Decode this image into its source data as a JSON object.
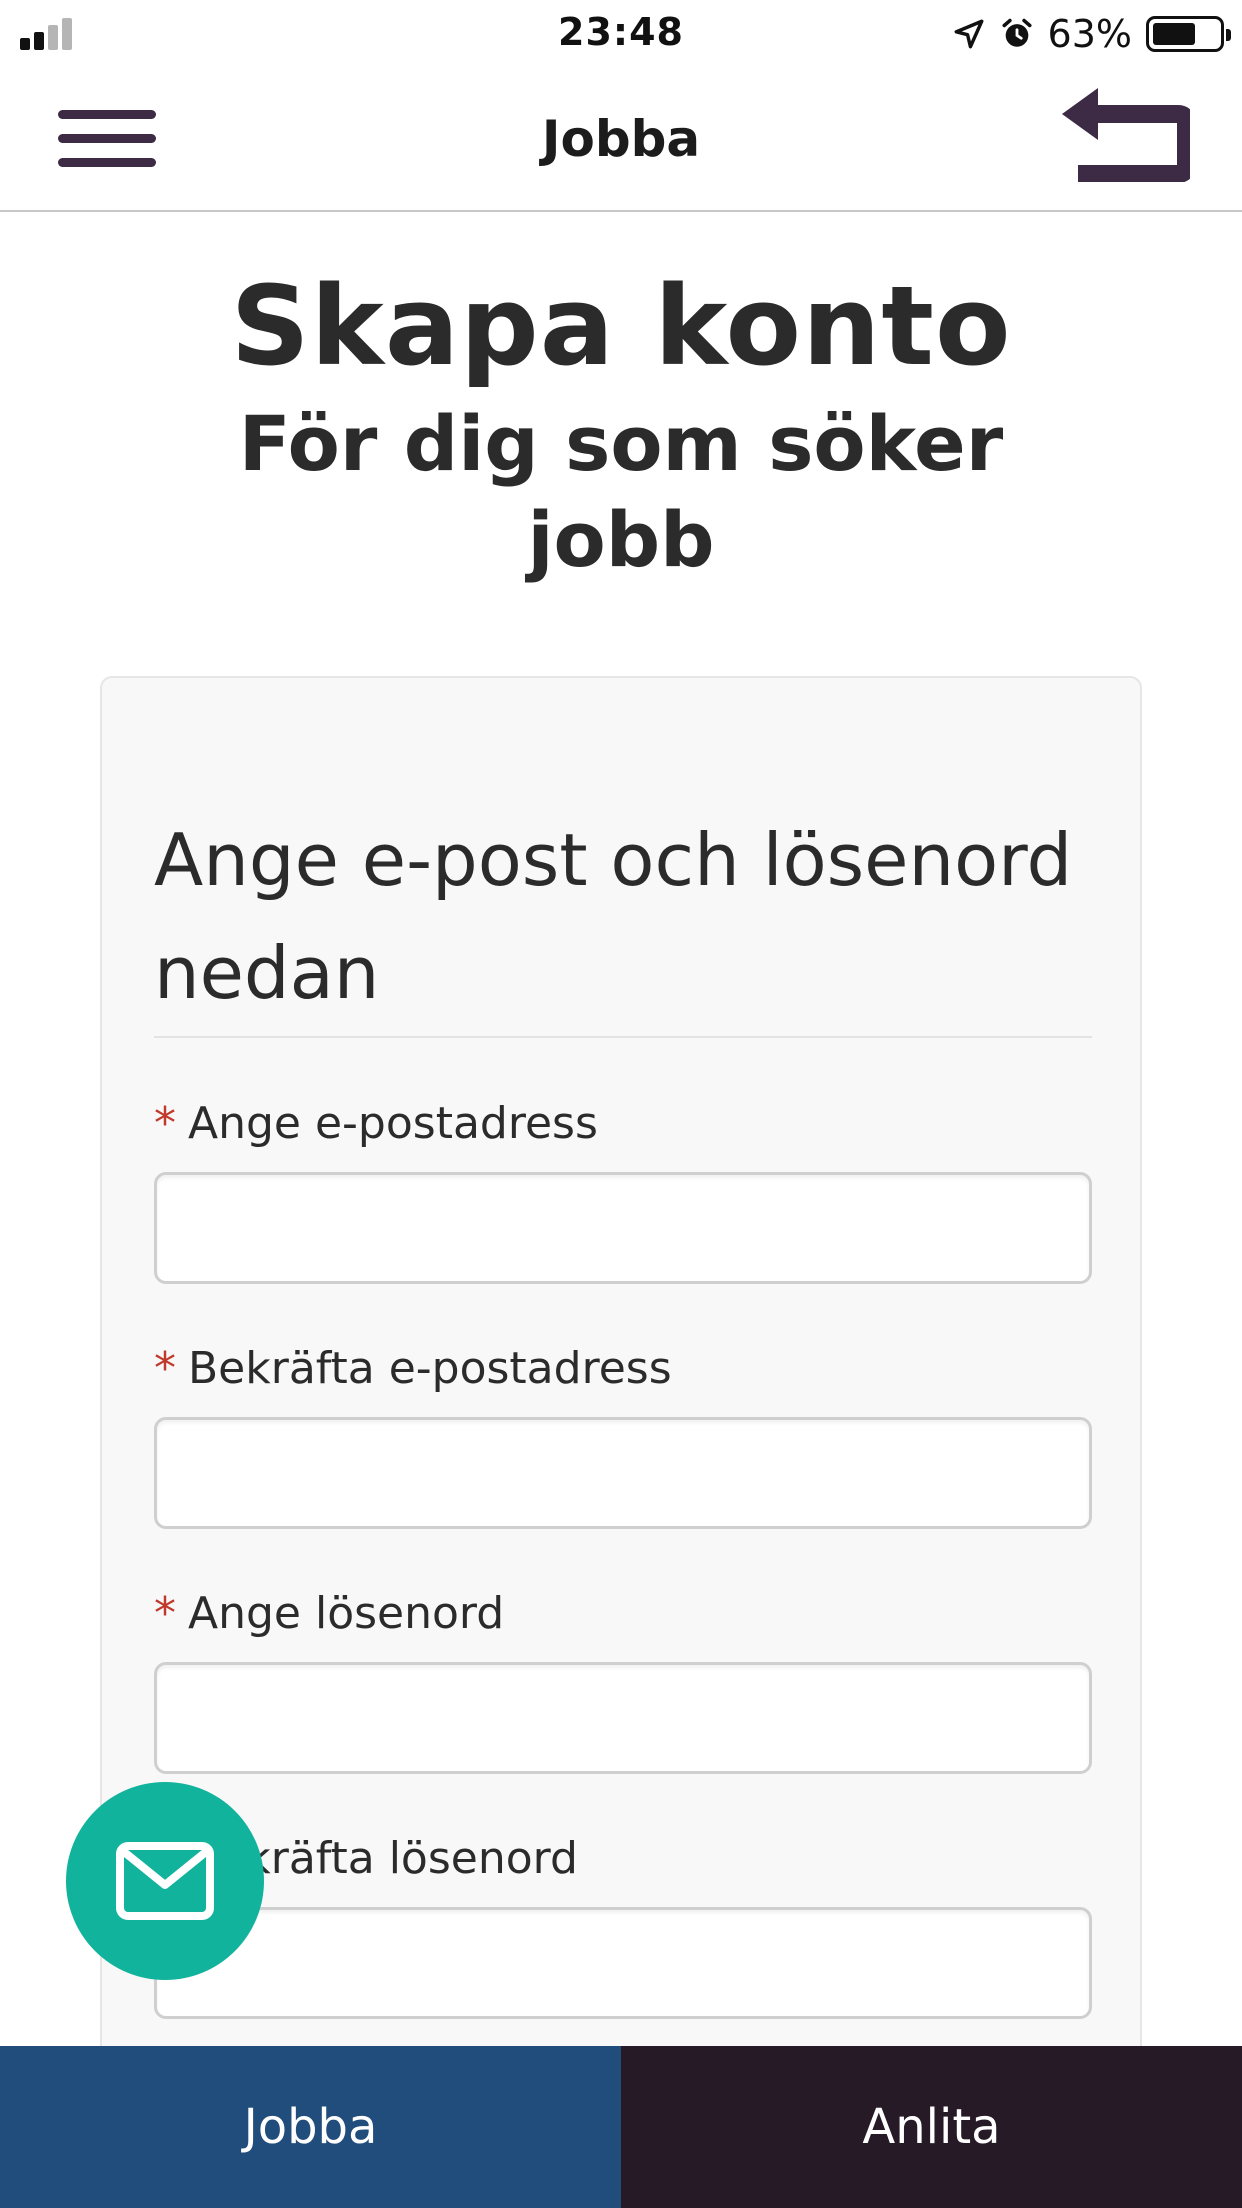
{
  "status_bar": {
    "time": "23:48",
    "battery_percent": "63%",
    "battery_level": 0.63,
    "icons": [
      "signal-icon",
      "location-arrow-icon",
      "alarm-icon",
      "battery-icon"
    ]
  },
  "nav": {
    "title": "Jobba",
    "menu_icon": "hamburger-menu-icon",
    "back_icon": "return-arrow-icon",
    "icon_color": "#3d2a45"
  },
  "page": {
    "title": "Skapa konto",
    "subtitle": "För dig som söker jobb"
  },
  "form": {
    "heading": "Ange e-post och lösenord nedan",
    "required_marker": "*",
    "required_color": "#c0392b",
    "fields": [
      {
        "label": "Ange e-postadress",
        "value": "",
        "placeholder": ""
      },
      {
        "label": "Bekräfta e-postadress",
        "value": "",
        "placeholder": ""
      },
      {
        "label": "Ange lösenord",
        "value": "",
        "placeholder": ""
      },
      {
        "label": "Bekräfta lösenord",
        "value": "",
        "placeholder": ""
      }
    ]
  },
  "fab": {
    "icon": "mail-icon",
    "color": "#12b39d"
  },
  "bottom_tabs": [
    {
      "label": "Jobba",
      "color": "#214d7d"
    },
    {
      "label": "Anlita",
      "color": "#271a27"
    }
  ]
}
